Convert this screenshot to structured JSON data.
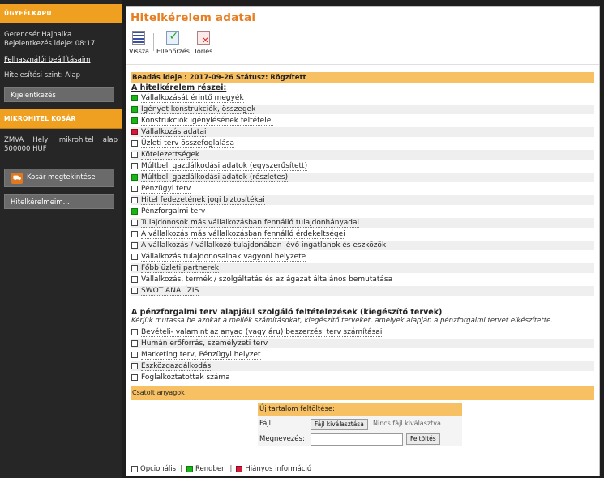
{
  "sidebar": {
    "client_section_title": "ÜGYFÉLKAPU",
    "user_name": "Gerencsér Hajnalka",
    "login_time": "Bejelentkezés ideje: 08:17",
    "settings_link": "Felhasználói beállításaim",
    "auth_level": "Hitelesítési szint: Alap",
    "logout_button": "Kijelentkezés",
    "cart_section_title": "MIKROHITEL KOSÁR",
    "cart_item": "ZMVA Helyi mikrohitel alap 500000 HUF",
    "cart_view_button": "Kosár megtekintése",
    "my_loans_button": "Hitelkérelmeim..."
  },
  "main": {
    "title": "Hitelkérelem adatai",
    "toolbar": {
      "back": "Vissza",
      "check": "Ellenőrzés",
      "delete": "Törlés"
    },
    "submission_info": "Beadás ideje : 2017-09-26 Státusz: Rögzített",
    "parts_heading": "A hitelkérelem részei:",
    "parts": [
      {
        "label": "Vállalkozását érintő megyék",
        "status": "green"
      },
      {
        "label": "Igényet konstrukciók, összegek",
        "status": "green"
      },
      {
        "label": "Konstrukciók igénylésének feltételei",
        "status": "green"
      },
      {
        "label": "Vállalkozás adatai",
        "status": "red"
      },
      {
        "label": "Üzleti terv összefoglalása",
        "status": "empty"
      },
      {
        "label": "Kötelezettségek",
        "status": "empty"
      },
      {
        "label": "Múltbeli gazdálkodási adatok (egyszerűsített)",
        "status": "empty"
      },
      {
        "label": "Múltbeli gazdálkodási adatok (részletes)",
        "status": "green"
      },
      {
        "label": "Pénzügyi terv",
        "status": "empty"
      },
      {
        "label": "Hitel fedezetének jogi biztosítékai",
        "status": "empty"
      },
      {
        "label": "Pénzforgalmi terv",
        "status": "green"
      },
      {
        "label": "Tulajdonosok más vállalkozásban fennálló tulajdonhányadai",
        "status": "empty"
      },
      {
        "label": "A vállalkozás más vállalkozásban fennálló érdekeltségei",
        "status": "empty"
      },
      {
        "label": "A vállalkozás / vállalkozó tulajdonában lévő ingatlanok és eszközök",
        "status": "empty"
      },
      {
        "label": "Vállalkozás tulajdonosainak vagyoni helyzete",
        "status": "empty"
      },
      {
        "label": "Főbb üzleti partnerek",
        "status": "empty"
      },
      {
        "label": "Vállalkozás, termék / szolgáltatás és az ágazat általános bemutatása",
        "status": "empty"
      },
      {
        "label": "SWOT ANALÍZIS",
        "status": "empty"
      }
    ],
    "supplementary_heading": "A pénzforgalmi terv alapjául szolgáló feltételezések (kiegészítő tervek)",
    "supplementary_hint": "Kérjük mutassa be azokat a mellék számításokat, kiegészítő terveket, amelyek alapján a pénzforgalmi tervet elkészítette.",
    "supplementary": [
      {
        "label": "Bevételi- valamint az anyag (vagy áru) beszerzési terv számításai",
        "status": "empty"
      },
      {
        "label": "Humán erőforrás, személyzeti terv",
        "status": "empty"
      },
      {
        "label": "Marketing terv, Pénzügyi helyzet",
        "status": "empty"
      },
      {
        "label": "Eszközgazdálkodás",
        "status": "empty"
      },
      {
        "label": "Foglalkoztatottak száma",
        "status": "empty"
      }
    ],
    "attachments_heading": "Csatolt anyagok",
    "upload": {
      "heading": "Új tartalom feltöltése:",
      "file_label": "Fájl:",
      "choose_button": "Fájl kiválasztása",
      "no_file": "Nincs fájl kiválasztva",
      "name_label": "Megnevezés:",
      "name_value": "",
      "upload_button": "Feltöltés"
    },
    "legend": {
      "optional": "Opcionális",
      "ok": "Rendben",
      "missing": "Hiányos információ"
    }
  },
  "colors": {
    "accent": "#e67e22",
    "bar": "#f7c063",
    "ok": "#18b418",
    "missing": "#d81a3a"
  }
}
